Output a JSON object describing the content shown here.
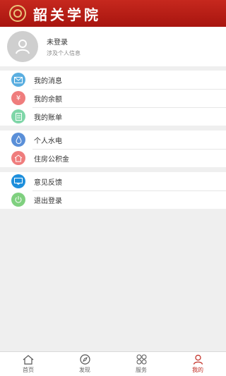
{
  "header": {
    "title": "韶关学院",
    "brand_color": "#b51d15"
  },
  "profile": {
    "name": "未登录",
    "subtitle": "涉及个人信息"
  },
  "groups": [
    {
      "items": [
        {
          "label": "我的消息",
          "icon": "mail-icon",
          "color": "#5aaee0"
        },
        {
          "label": "我的余额",
          "icon": "yen-icon",
          "color": "#ef7d7d"
        },
        {
          "label": "我的账单",
          "icon": "document-icon",
          "color": "#7fd6a8"
        }
      ]
    },
    {
      "items": [
        {
          "label": "个人水电",
          "icon": "water-drop-icon",
          "color": "#5a8fd8"
        },
        {
          "label": "住房公积金",
          "icon": "house-icon",
          "color": "#ef7d7d"
        }
      ]
    },
    {
      "items": [
        {
          "label": "意见反馈",
          "icon": "feedback-icon",
          "color": "#1e8fdc"
        },
        {
          "label": "退出登录",
          "icon": "power-icon",
          "color": "#7fd07f"
        }
      ]
    }
  ],
  "tabbar": [
    {
      "label": "首页",
      "icon": "home-icon"
    },
    {
      "label": "发现",
      "icon": "compass-icon"
    },
    {
      "label": "服务",
      "icon": "grid-icon"
    },
    {
      "label": "我的",
      "icon": "user-icon",
      "active": true
    }
  ]
}
